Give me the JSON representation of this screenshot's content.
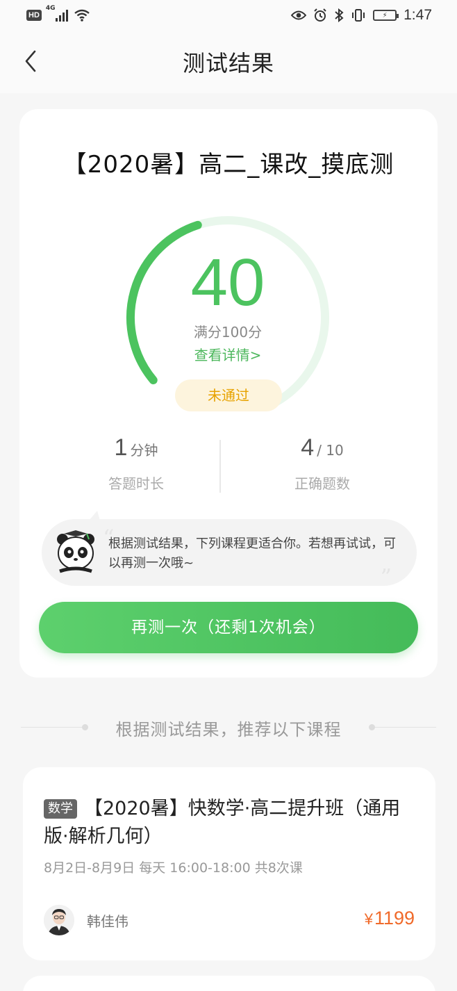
{
  "status_bar": {
    "network": "HD",
    "signal_label": "4G",
    "time": "1:47"
  },
  "nav": {
    "title": "测试结果"
  },
  "result": {
    "test_title": "【2020暑】高二_课改_摸底测",
    "score": "40",
    "score_value": 40,
    "max_score_value": 100,
    "full_score_text": "满分100分",
    "details_link": "查看详情>",
    "status": "未通过",
    "time_value": "1",
    "time_unit": "分钟",
    "time_label": "答题时长",
    "correct_value": "4",
    "correct_total": "/ 10",
    "correct_label": "正确题数",
    "tip_text": "根据测试结果，下列课程更适合你。若想再试试，可以再测一次哦~",
    "retry_button": "再测一次（还剩1次机会）"
  },
  "recommend": {
    "heading": "根据测试结果，推荐以下课程",
    "courses": [
      {
        "tag": "数学",
        "title": "【2020暑】快数学·高二提升班（通用版·解析几何）",
        "schedule": "8月2日-8月9日 每天 16:00-18:00 共8次课",
        "teacher": "韩佳伟",
        "currency": "¥",
        "price": "1199"
      }
    ]
  },
  "colors": {
    "accent_green": "#4cc35f",
    "fail_yellow": "#e7a200",
    "price_orange": "#f06a2a"
  },
  "icons": {
    "back": "chevron-left-icon",
    "eye": "eye-icon",
    "alarm": "alarm-icon",
    "bluetooth": "bluetooth-icon",
    "vibrate": "vibrate-icon",
    "battery": "battery-icon",
    "wifi": "wifi-icon"
  }
}
